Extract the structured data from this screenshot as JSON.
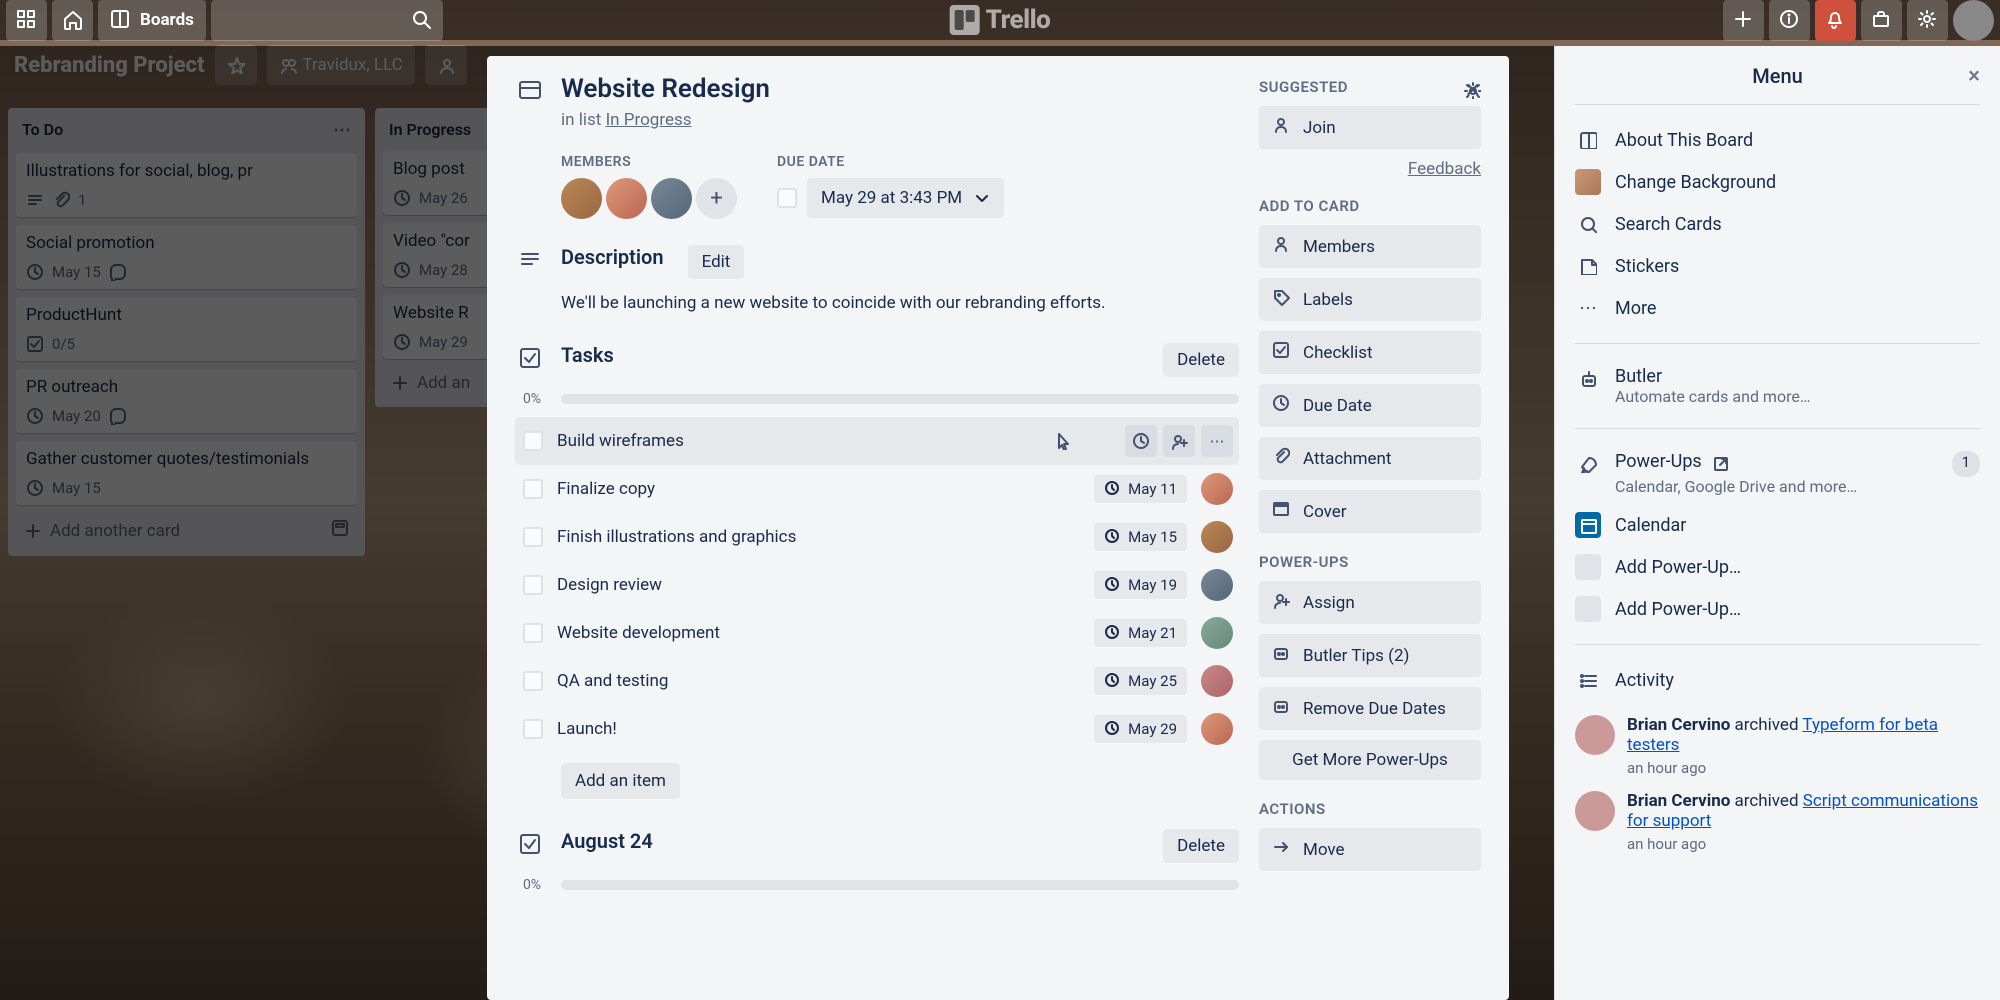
{
  "nav": {
    "boards": "Boards",
    "logo_text": "Trello"
  },
  "board_header": {
    "title": "Rebranding Project",
    "team": "Travidux, LLC"
  },
  "lists": [
    {
      "title": "To Do",
      "cards": [
        {
          "title": "Illustrations for social, blog, pr",
          "date": "",
          "checks": "1",
          "attach": true
        },
        {
          "title": "Social promotion",
          "date": "May 15",
          "comments": true
        },
        {
          "title": "ProductHunt",
          "date": "",
          "checks": "0/5"
        },
        {
          "title": "PR outreach",
          "date": "May 20",
          "comments": true
        },
        {
          "title": "Gather customer quotes/testimonials",
          "date": "May 15"
        }
      ],
      "add": "Add another card"
    },
    {
      "title": "In Progress",
      "cards": [
        {
          "title": "Blog post",
          "date": "May 26"
        },
        {
          "title": "Video \"cor",
          "date": "May 28"
        },
        {
          "title": "Website R",
          "date": "May 29"
        }
      ],
      "add": "Add an"
    }
  ],
  "menu": {
    "title": "Menu",
    "about": "About This Board",
    "change_bg": "Change Background",
    "search": "Search Cards",
    "stickers": "Stickers",
    "more": "More",
    "butler": "Butler",
    "butler_sub": "Automate cards and more…",
    "powerups": "Power-Ups",
    "powerups_sub": "Calendar, Google Drive and more…",
    "powerups_count": "1",
    "calendar": "Calendar",
    "add_pu": "Add Power-Up…",
    "activity": "Activity",
    "act1_user": "Brian Cervino",
    "act1_verb": " archived ",
    "act1_link": "Typeform for beta testers",
    "act2_user": "Brian Cervino",
    "act2_verb": " archived ",
    "act2_link": "Script communications for support",
    "act_time": "an hour ago"
  },
  "modal": {
    "title": "Website Redesign",
    "in_list_prefix": "in list ",
    "in_list": "In Progress",
    "members_label": "MEMBERS",
    "due_label": "DUE DATE",
    "due_value": "May 29 at 3:43 PM",
    "desc_title": "Description",
    "edit": "Edit",
    "desc_text": "We'll be launching a new website to coincide with our rebranding efforts.",
    "tasks_title": "Tasks",
    "delete": "Delete",
    "progress": "0%",
    "tasks": [
      {
        "text": "Build wireframes",
        "date": ""
      },
      {
        "text": "Finalize copy",
        "date": "May 11"
      },
      {
        "text": "Finish illustrations and graphics",
        "date": "May 15"
      },
      {
        "text": "Design review",
        "date": "May 19"
      },
      {
        "text": "Website development",
        "date": "May 21"
      },
      {
        "text": "QA and testing",
        "date": "May 25"
      },
      {
        "text": "Launch!",
        "date": "May 29"
      }
    ],
    "add_item": "Add an item",
    "checklist2": "August 24",
    "side": {
      "suggested": "SUGGESTED",
      "join": "Join",
      "feedback": "Feedback",
      "add_to_card": "ADD TO CARD",
      "members": "Members",
      "labels": "Labels",
      "checklist": "Checklist",
      "due": "Due Date",
      "attachment": "Attachment",
      "cover": "Cover",
      "powerups": "POWER-UPS",
      "assign": "Assign",
      "butler_tips": "Butler Tips (2)",
      "remove_due": "Remove Due Dates",
      "get_more": "Get More Power-Ups",
      "actions": "ACTIONS",
      "move": "Move"
    }
  }
}
